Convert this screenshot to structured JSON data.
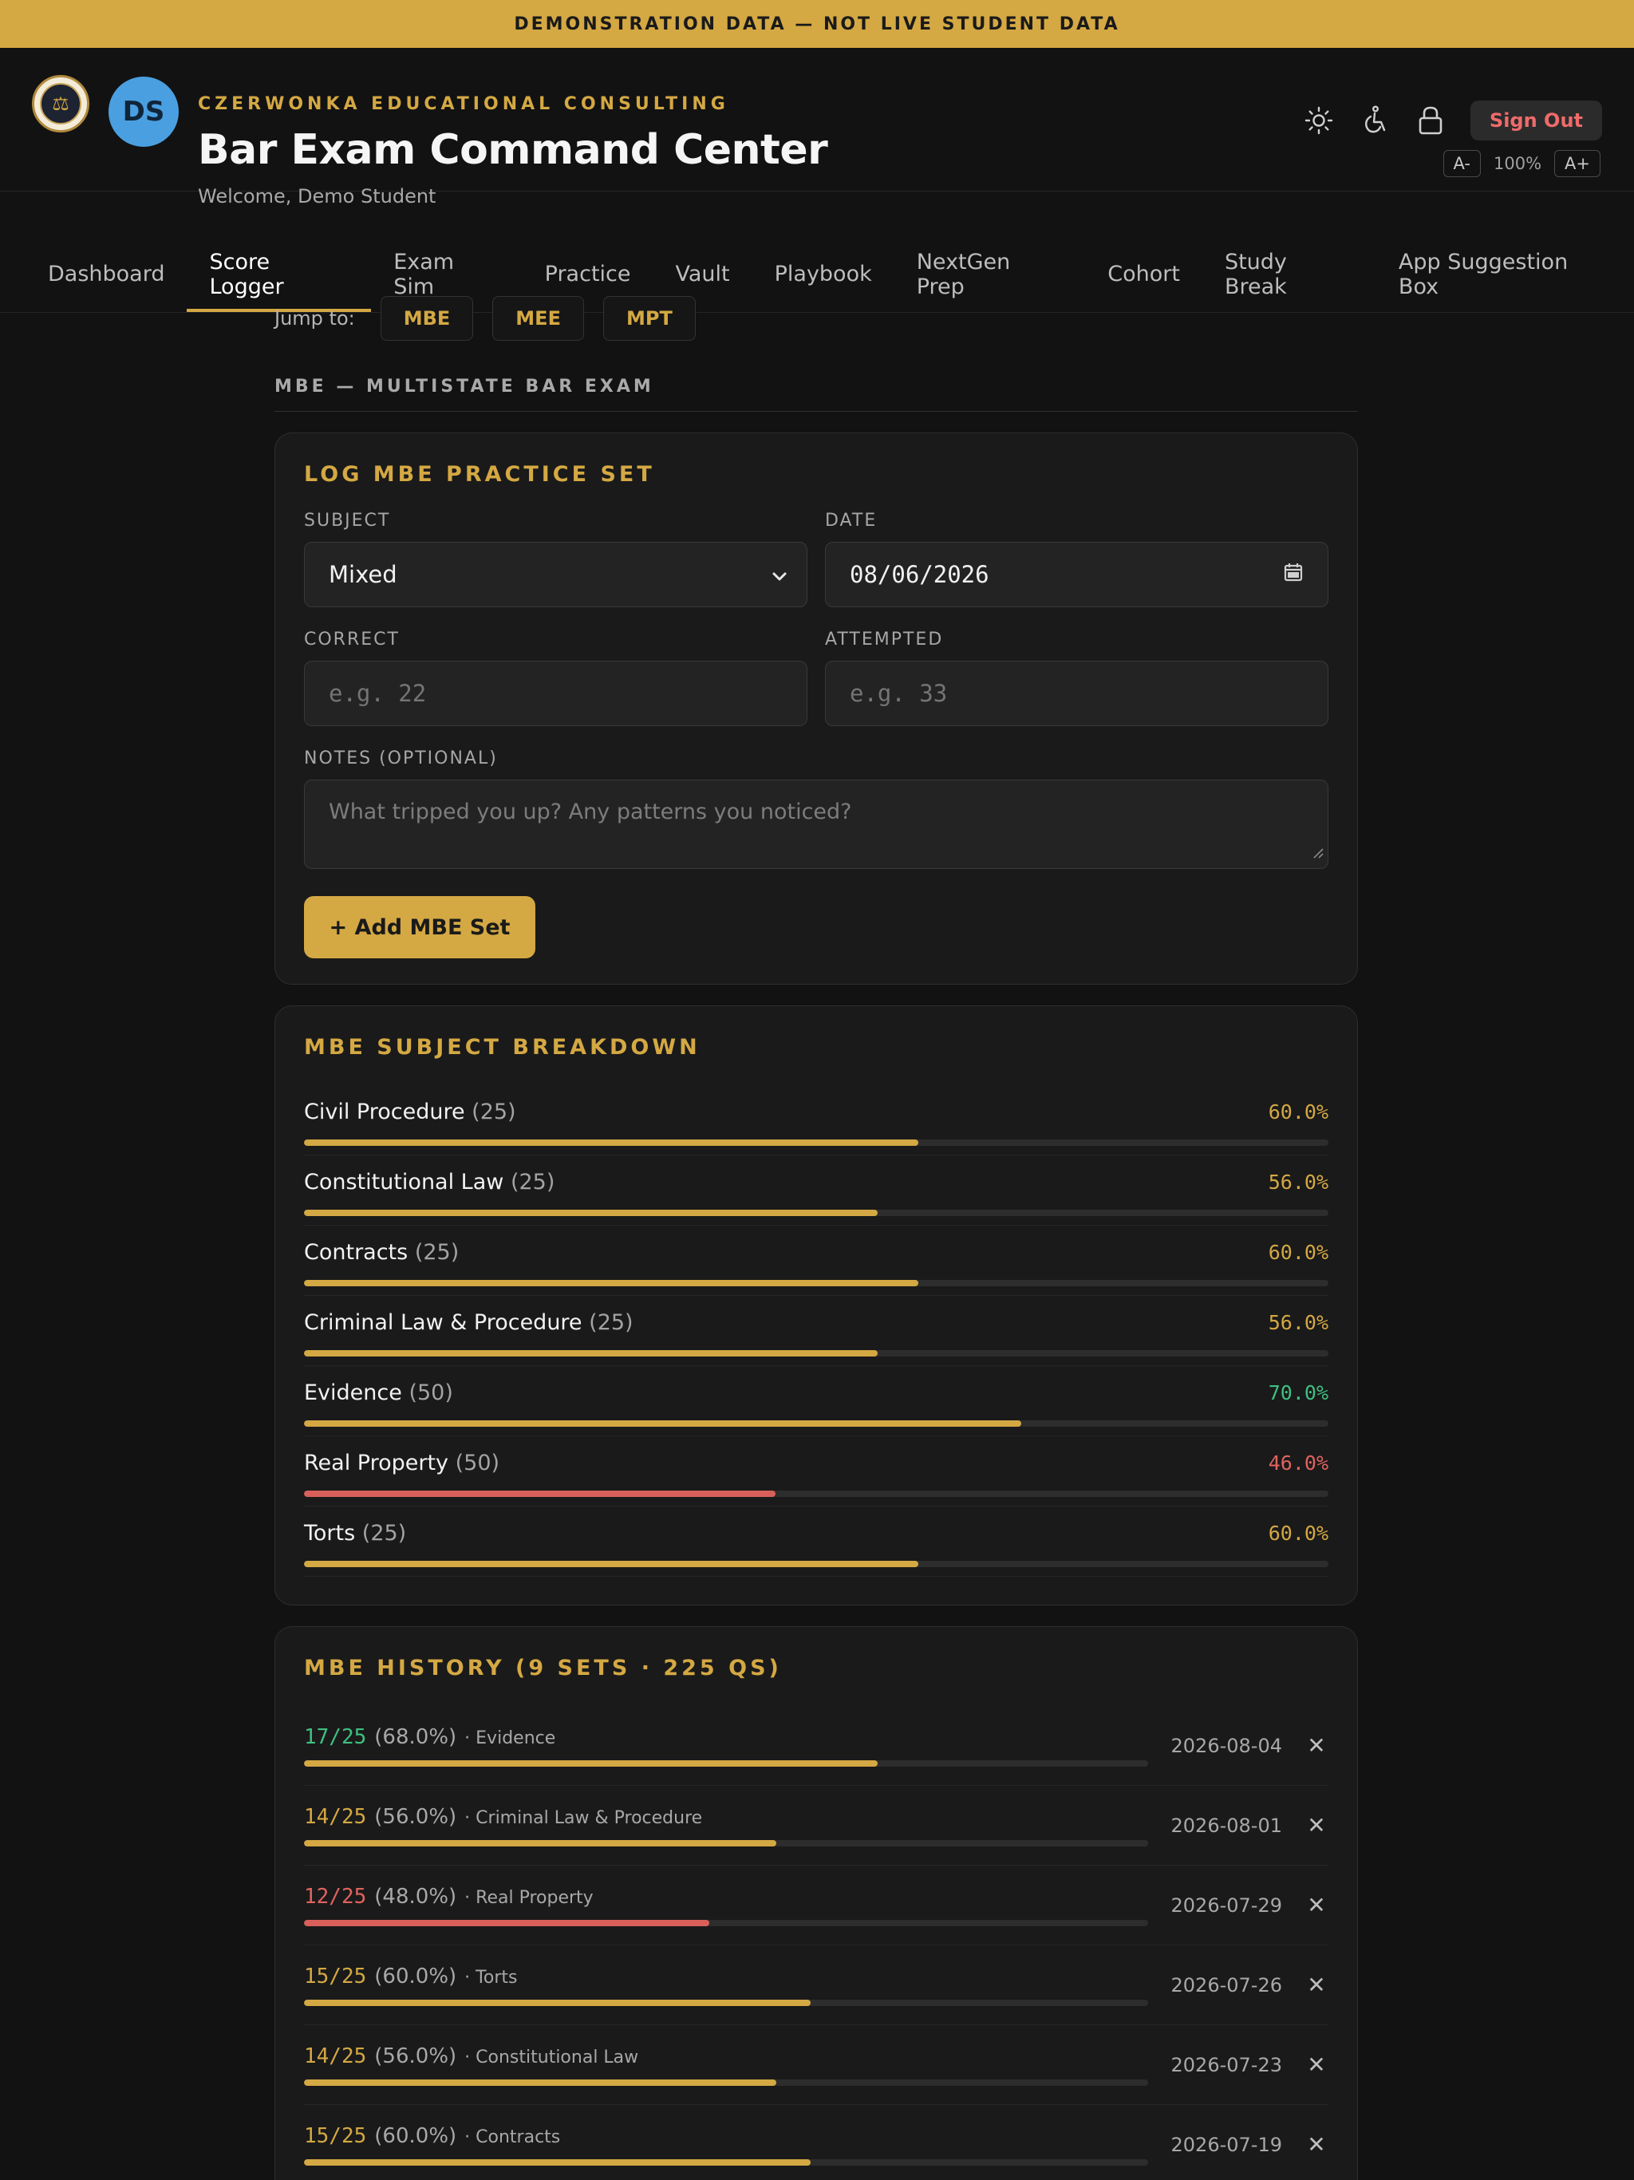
{
  "banner": {
    "text": "DEMONSTRATION DATA — NOT LIVE STUDENT DATA"
  },
  "header": {
    "firm": "CZERWONKA EDUCATIONAL CONSULTING",
    "title": "Bar Exam Command Center",
    "welcome": "Welcome, Demo Student",
    "avatar_initials": "DS",
    "sign_out": "Sign Out",
    "font_decrease": "A-",
    "zoom": "100%",
    "font_increase": "A+"
  },
  "nav": {
    "tabs": [
      {
        "label": "Dashboard"
      },
      {
        "label": "Score Logger",
        "active": true
      },
      {
        "label": "Exam Sim"
      },
      {
        "label": "Practice"
      },
      {
        "label": "Vault"
      },
      {
        "label": "Playbook"
      },
      {
        "label": "NextGen Prep"
      },
      {
        "label": "Cohort"
      },
      {
        "label": "Study Break"
      },
      {
        "label": "App Suggestion Box"
      }
    ]
  },
  "jump": {
    "label": "Jump to:",
    "buttons": [
      "MBE",
      "MEE",
      "MPT"
    ]
  },
  "section": {
    "heading": "MBE — MULTISTATE BAR EXAM"
  },
  "log_form": {
    "title": "LOG MBE PRACTICE SET",
    "subject_label": "SUBJECT",
    "subject_value": "Mixed",
    "date_label": "DATE",
    "date_value": "08/06/2026",
    "correct_label": "CORRECT",
    "correct_placeholder": "e.g. 22",
    "attempted_label": "ATTEMPTED",
    "attempted_placeholder": "e.g. 33",
    "notes_label": "NOTES (OPTIONAL)",
    "notes_placeholder": "What tripped you up? Any patterns you noticed?",
    "add_button": "+ Add MBE Set"
  },
  "breakdown": {
    "title": "MBE SUBJECT BREAKDOWN",
    "rows": [
      {
        "subject": "Civil Procedure",
        "count": "(25)",
        "pct": "60.0%",
        "value": 60.0,
        "status": "mid"
      },
      {
        "subject": "Constitutional Law",
        "count": "(25)",
        "pct": "56.0%",
        "value": 56.0,
        "status": "mid"
      },
      {
        "subject": "Contracts",
        "count": "(25)",
        "pct": "60.0%",
        "value": 60.0,
        "status": "mid"
      },
      {
        "subject": "Criminal Law & Procedure",
        "count": "(25)",
        "pct": "56.0%",
        "value": 56.0,
        "status": "mid"
      },
      {
        "subject": "Evidence",
        "count": "(50)",
        "pct": "70.0%",
        "value": 70.0,
        "status": "high"
      },
      {
        "subject": "Real Property",
        "count": "(50)",
        "pct": "46.0%",
        "value": 46.0,
        "status": "low"
      },
      {
        "subject": "Torts",
        "count": "(25)",
        "pct": "60.0%",
        "value": 60.0,
        "status": "mid"
      }
    ]
  },
  "history": {
    "title": "MBE HISTORY (9 SETS · 225 QS)",
    "rows": [
      {
        "score": "17/25",
        "pct": "(68.0%)",
        "subject": "· Evidence",
        "date": "2026-08-04",
        "value": 68.0,
        "status": "high"
      },
      {
        "score": "14/25",
        "pct": "(56.0%)",
        "subject": "· Criminal Law & Procedure",
        "date": "2026-08-01",
        "value": 56.0,
        "status": "mid"
      },
      {
        "score": "12/25",
        "pct": "(48.0%)",
        "subject": "· Real Property",
        "date": "2026-07-29",
        "value": 48.0,
        "status": "low"
      },
      {
        "score": "15/25",
        "pct": "(60.0%)",
        "subject": "· Torts",
        "date": "2026-07-26",
        "value": 60.0,
        "status": "mid"
      },
      {
        "score": "14/25",
        "pct": "(56.0%)",
        "subject": "· Constitutional Law",
        "date": "2026-07-23",
        "value": 56.0,
        "status": "mid"
      },
      {
        "score": "15/25",
        "pct": "(60.0%)",
        "subject": "· Contracts",
        "date": "2026-07-19",
        "value": 60.0,
        "status": "mid"
      }
    ],
    "delete_glyph": "✕"
  },
  "colors": {
    "accent": "#d4a843",
    "high": "#3fbf80",
    "mid": "#d4a843",
    "low": "#e0635f",
    "bar_low": "#d9605a"
  }
}
